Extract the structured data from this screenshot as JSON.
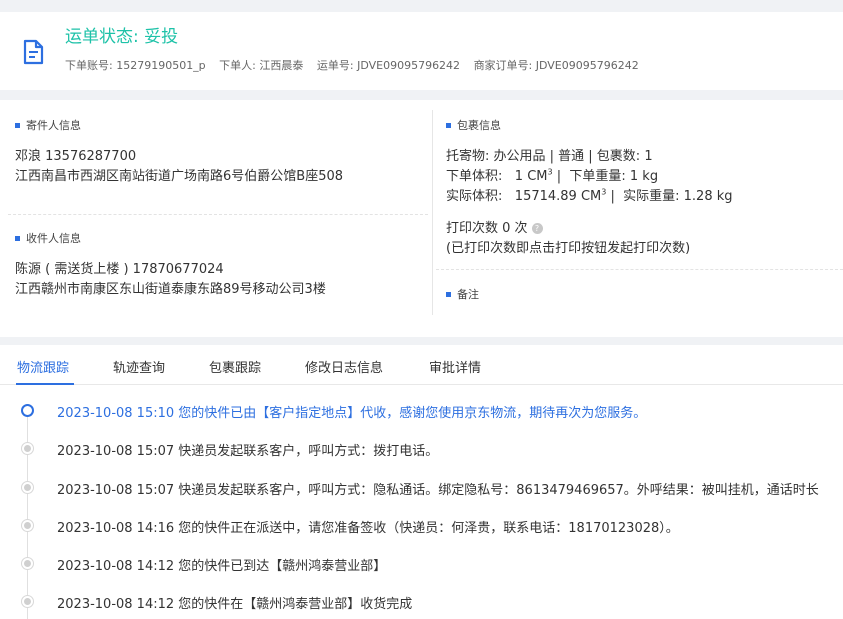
{
  "header": {
    "status_label": "运单状态: 妥投",
    "order_account": "下单账号: 15279190501_p",
    "orderer": "下单人: 江西晨泰",
    "waybill_no": "运单号: JDVE09095796242",
    "merchant_order_no": "商家订单号: JDVE09095796242"
  },
  "sender": {
    "title": "寄件人信息",
    "name_phone": "邓浪   13576287700",
    "address": "江西南昌市西湖区南站街道广场南路6号伯爵公馆B座508"
  },
  "receiver": {
    "title": "收件人信息",
    "name_phone": "陈源 ( 需送货上楼 )     17870677024",
    "address": "江西赣州市南康区东山街道泰康东路89号移动公司3楼"
  },
  "package": {
    "title": "包裹信息",
    "goods": "托寄物:  办公用品 | 普通  |  包裹数:  1",
    "order_volume_label": "下单体积:",
    "order_volume_value": "1 CM",
    "order_weight": "下单重量:   1 kg",
    "actual_volume_label": "实际体积:",
    "actual_volume_value": "15714.89 CM",
    "actual_weight": "实际重量:   1.28 kg",
    "volume_unit_power": "3",
    "print_count": "打印次数   0 次",
    "print_hint": "(已打印次数即点击打印按钮发起打印次数)"
  },
  "remark": {
    "title": "备注"
  },
  "tabs": [
    {
      "label": "物流跟踪"
    },
    {
      "label": "轨迹查询"
    },
    {
      "label": "包裹跟踪"
    },
    {
      "label": "修改日志信息"
    },
    {
      "label": "审批详情"
    }
  ],
  "timeline": [
    {
      "text": "2023-10-08 15:10 您的快件已由【客户指定地点】代收，感谢您使用京东物流，期待再次为您服务。"
    },
    {
      "text": "2023-10-08 15:07 快递员发起联系客户，呼叫方式：拨打电话。"
    },
    {
      "text": "2023-10-08 15:07 快递员发起联系客户，呼叫方式：隐私通话。绑定隐私号：8613479469657。外呼结果：被叫挂机，通话时长"
    },
    {
      "text": "2023-10-08 14:16 您的快件正在派送中，请您准备签收（快递员：何泽贵，联系电话：18170123028）。"
    },
    {
      "text": "2023-10-08 14:12 您的快件已到达【赣州鸿泰营业部】"
    },
    {
      "text": "2023-10-08 14:12 您的快件在【赣州鸿泰营业部】收货完成"
    }
  ],
  "colors": {
    "status_green": "#1ec2a8",
    "accent_blue": "#2d6fe0"
  },
  "icons": {
    "header": "document-icon",
    "print_help": "help-icon"
  }
}
